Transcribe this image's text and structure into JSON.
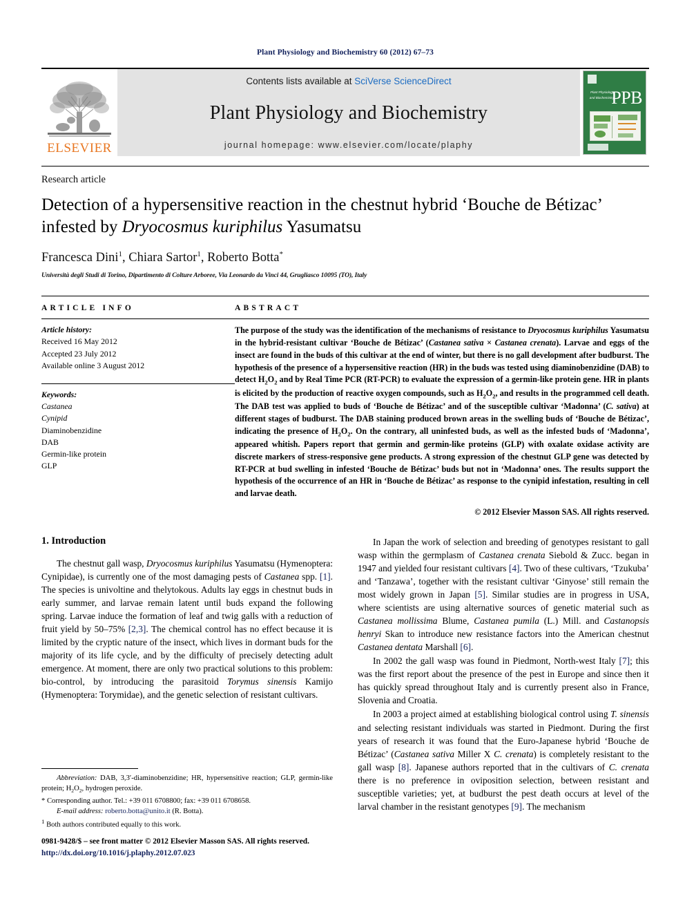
{
  "running_head": "Plant Physiology and Biochemistry 60 (2012) 67–73",
  "masthead": {
    "publisher_logo_label": "ELSEVIER",
    "contents_prefix": "Contents lists available at ",
    "contents_link": "SciVerse ScienceDirect",
    "journal_title": "Plant Physiology and Biochemistry",
    "homepage_line": "journal homepage: www.elsevier.com/locate/plaphy",
    "cover": {
      "acronym": "PPB",
      "cover_journal_title": "Plant Physiology and Biochemistry"
    }
  },
  "article": {
    "type": "Research article",
    "title_line1": "Detection of a hypersensitive reaction in the chestnut hybrid ‘Bouche de Bétizac’",
    "title_line2_pre": "infested by ",
    "title_line2_italic": "Dryocosmus kuriphilus",
    "title_line2_post": " Yasumatsu",
    "authors": [
      {
        "name": "Francesca Dini",
        "marker": "1",
        "sep": ", "
      },
      {
        "name": "Chiara Sartor",
        "marker": "1",
        "sep": ", "
      },
      {
        "name": "Roberto Botta",
        "marker": "*",
        "sep": ""
      }
    ],
    "affiliation": "Università degli Studi di Torino, Dipartimento di Colture Arboree, Via Leonardo da Vinci 44, Grugliasco 10095 (TO), Italy"
  },
  "article_info": {
    "label": "ARTICLE INFO",
    "history_label": "Article history:",
    "history": [
      "Received 16 May 2012",
      "Accepted 23 July 2012",
      "Available online 3 August 2012"
    ],
    "keywords_label": "Keywords:",
    "keywords": [
      {
        "text": "Castanea",
        "italic": true
      },
      {
        "text": "Cynipid",
        "italic": true
      },
      {
        "text": "Diaminobenzidine",
        "italic": false
      },
      {
        "text": "DAB",
        "italic": false
      },
      {
        "text": "Germin-like protein",
        "italic": false
      },
      {
        "text": "GLP",
        "italic": false
      }
    ]
  },
  "abstract": {
    "label": "ABSTRACT",
    "text": "The purpose of the study was the identification of the mechanisms of resistance to Dryocosmus kuriphilus Yasumatsu in the hybrid-resistant cultivar ‘Bouche de Bétizac’ (Castanea sativa × Castanea crenata). Larvae and eggs of the insect are found in the buds of this cultivar at the end of winter, but there is no gall development after budburst. The hypothesis of the presence of a hypersensitive reaction (HR) in the buds was tested using diaminobenzidine (DAB) to detect H2O2 and by Real Time PCR (RT-PCR) to evaluate the expression of a germin-like protein gene. HR in plants is elicited by the production of reactive oxygen compounds, such as H2O2, and results in the programmed cell death. The DAB test was applied to buds of ‘Bouche de Bétizac’ and of the susceptible cultivar ‘Madonna’ (C. sativa) at different stages of budburst. The DAB staining produced brown areas in the swelling buds of ‘Bouche de Bétizac’, indicating the presence of H2O2. On the contrary, all uninfested buds, as well as the infested buds of ‘Madonna’, appeared whitish. Papers report that germin and germin-like proteins (GLP) with oxalate oxidase activity are discrete markers of stress-responsive gene products. A strong expression of the chestnut GLP gene was detected by RT-PCR at bud swelling in infested ‘Bouche de Bétizac’ buds but not in ‘Madonna’ ones. The results support the hypothesis of the occurrence of an HR in ‘Bouche de Bétizac’ as response to the cynipid infestation, resulting in cell and larvae death.",
    "copyright": "© 2012 Elsevier Masson SAS. All rights reserved."
  },
  "introduction": {
    "heading": "1. Introduction",
    "left_paragraphs": [
      "The chestnut gall wasp, Dryocosmus kuriphilus Yasumatsu (Hymenoptera: Cynipidae), is currently one of the most damaging pests of Castanea spp. [1]. The species is univoltine and thelytokous. Adults lay eggs in chestnut buds in early summer, and larvae remain latent until buds expand the following spring. Larvae induce the formation of leaf and twig galls with a reduction of fruit yield by 50–75% [2,3]. The chemical control has no effect because it is limited by the cryptic nature of the insect, which lives in dormant buds for the majority of its life cycle, and by the difficulty of precisely detecting adult emergence. At moment, there are only two practical solutions to this problem: bio-control, by introducing the parasitoid Torymus sinensis Kamijo (Hymenoptera: Torymidae), and the genetic selection of resistant cultivars."
    ],
    "right_paragraphs": [
      "In Japan the work of selection and breeding of genotypes resistant to gall wasp within the germplasm of Castanea crenata Siebold & Zucc. began in 1947 and yielded four resistant cultivars [4]. Two of these cultivars, ‘Tzukuba’ and ‘Tanzawa’, together with the resistant cultivar ‘Ginyose’ still remain the most widely grown in Japan [5]. Similar studies are in progress in USA, where scientists are using alternative sources of genetic material such as Castanea mollissima Blume, Castanea pumila (L.) Mill. and Castanopsis henryi Skan to introduce new resistance factors into the American chestnut Castanea dentata Marshall [6].",
      "In 2002 the gall wasp was found in Piedmont, North-west Italy [7]; this was the first report about the presence of the pest in Europe and since then it has quickly spread throughout Italy and is currently present also in France, Slovenia and Croatia.",
      "In 2003 a project aimed at establishing biological control using T. sinensis and selecting resistant individuals was started in Piedmont. During the first years of research it was found that the Euro-Japanese hybrid ‘Bouche de Bétizac’ (Castanea sativa Miller X C. crenata) is completely resistant to the gall wasp [8]. Japanese authors reported that in the cultivars of C. crenata there is no preference in oviposition selection, between resistant and susceptible varieties; yet, at budburst the pest death occurs at level of the larval chamber in the resistant genotypes [9]. The mechanism"
    ]
  },
  "footnotes": {
    "abbreviation_label": "Abbreviation:",
    "abbreviation_text": " DAB, 3,3′-diaminobenzidine; HR, hypersensitive reaction; GLP, germin-like protein; H2O2, hydrogen peroxide.",
    "corresponding_marker": "*",
    "corresponding_text": "Corresponding author. Tel.: +39 011 6708800; fax: +39 011 6708658.",
    "email_label": "E-mail address:",
    "email": "roberto.botta@unito.it",
    "email_suffix": " (R. Botta).",
    "equal_marker": "1",
    "equal_text": "Both authors contributed equally to this work."
  },
  "imprint": {
    "line1": "0981-9428/$ – see front matter © 2012 Elsevier Masson SAS. All rights reserved.",
    "doi": "http://dx.doi.org/10.1016/j.plaphy.2012.07.023"
  },
  "colors": {
    "header_band": "#e3e3e3",
    "link_blue": "#1c6cc2",
    "ref_navy": "#12215c",
    "elsevier_orange": "#e87722",
    "cover_green": "#2f7d45"
  }
}
